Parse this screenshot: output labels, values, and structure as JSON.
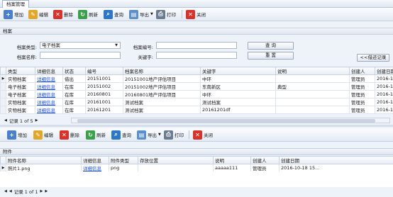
{
  "window": {
    "tab_label": "档案管理"
  },
  "toolbar_top": {
    "add": "增加",
    "edit": "编辑",
    "delete": "删除",
    "refresh": "刷新",
    "query": "查询",
    "export": "导出",
    "print": "打印",
    "close": "关闭"
  },
  "archive_section": {
    "title": "档案"
  },
  "filter": {
    "type_label": "档案类型:",
    "type_value": "电子档案",
    "number_label": "档案编号:",
    "number_value": "",
    "name_label": "档案名称:",
    "name_value": "",
    "keyword_label": "关键字:",
    "keyword_value": "",
    "query_button": "查 询",
    "reset_button": "重 置",
    "borrow_button": "<<借还记录"
  },
  "archive_table": {
    "columns": [
      "类型",
      "详细信息",
      "状态",
      "编号",
      "档案名称",
      "关键字",
      "说明",
      "创建人",
      "创建日期"
    ],
    "rows": [
      [
        "实物档案",
        "详细信息",
        "借出",
        "20151001",
        "20151001地产评估项目",
        "中环",
        "",
        "管理员",
        "2016-1"
      ],
      [
        "电子档案",
        "详细信息",
        "在库",
        "20151002",
        "20151002地产评估项目",
        "东南新区",
        "典型",
        "管理员",
        "2016-1"
      ],
      [
        "电子档案",
        "详细信息",
        "在库",
        "20160801",
        "20160801地产评估项目",
        "中环",
        "",
        "管理员",
        "2016-1"
      ],
      [
        "实物档案",
        "详细信息",
        "在库",
        "20161001",
        "测试档案",
        "测试档案",
        "",
        "管理员",
        "2016-1"
      ],
      [
        "实物档案",
        "详细信息",
        "在库",
        "20161201",
        "测试档案",
        "20161201df",
        "",
        "管理员",
        "2016-1"
      ]
    ]
  },
  "pager_top": {
    "text": "记录 1 of 5"
  },
  "toolbar_bottom": {
    "add": "增加",
    "edit": "编辑",
    "delete": "删除",
    "refresh": "刷新",
    "query": "查询",
    "export": "导出",
    "print": "打印",
    "close": "关闭"
  },
  "attachment_section": {
    "title": "附件"
  },
  "attachment_table": {
    "columns": [
      "附件名称",
      "详细信息",
      "附件类型",
      "存放位置",
      "说明",
      "创建人",
      "创建日期"
    ],
    "rows": [
      [
        "照片1.png",
        "详细信息",
        "png",
        "",
        "aaaaa111",
        "管理员",
        "2016-10-18 15..."
      ]
    ]
  },
  "pager_bottom": {
    "text": "记录 1 of 1"
  },
  "colors": {
    "accent": "#1a4fd6",
    "header_bg": "#dfe6f0",
    "delete_red": "#d8332a"
  }
}
